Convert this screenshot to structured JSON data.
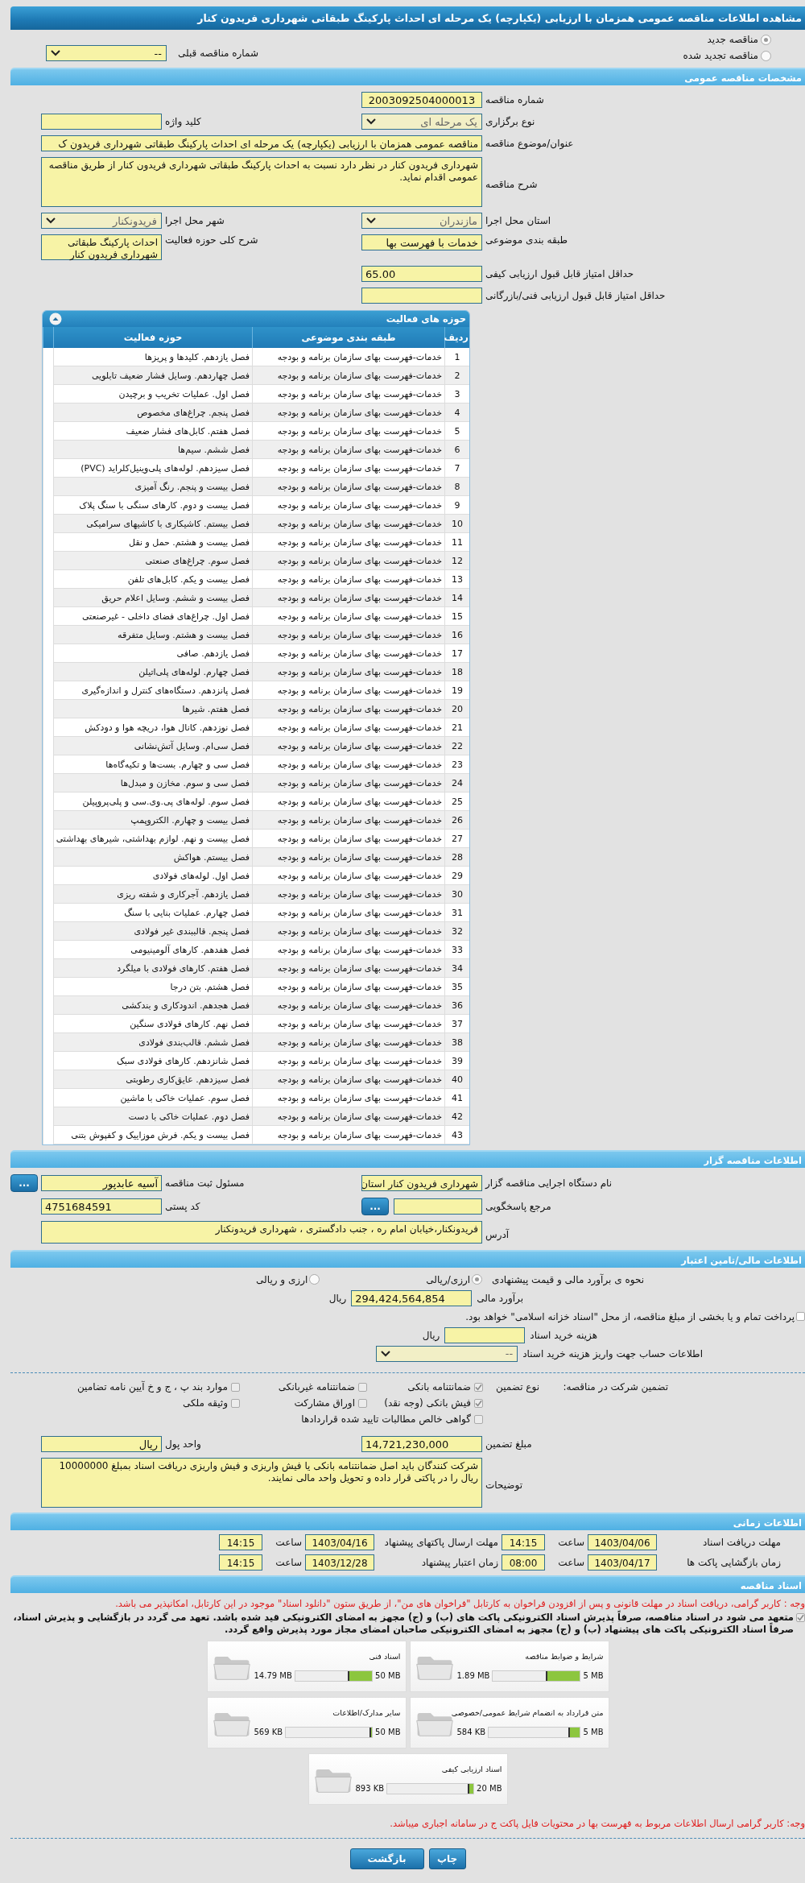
{
  "page_title": "مشاهده اطلاعات مناقصه عمومی همزمان با ارزیابی (یکپارچه) یک مرحله ای احداث پارکینگ طبقاتی شهرداری فریدون کنار",
  "tender_status": [
    {
      "label": "مناقصه جدید",
      "selected": true
    },
    {
      "label": "مناقصه تجدید شده",
      "selected": false
    }
  ],
  "previous_tender": {
    "label": "شماره مناقصه قبلی",
    "value": "--"
  },
  "general": {
    "title": "مشخصات مناقصه عمومی",
    "tender_number": {
      "label": "شماره مناقصه",
      "value": "2003092504000013"
    },
    "holding_type": {
      "label": "نوع برگزاری",
      "value": "یک مرحله ای"
    },
    "keyword": {
      "label": "کلید واژه"
    },
    "subject": {
      "label": "عنوان/موضوع مناقصه",
      "value": "مناقصه عمومی همزمان با ارزیابی (یکپارچه) یک مرحله ای احداث پارکینگ طبقاتی شهرداری فریدون ک"
    },
    "description": {
      "label": "شرح مناقصه",
      "value": "شهرداری فریدون کنار در نظر دارد نسبت به احداث پارکینگ طبقاتی شهرداری فریدون کنار از طریق مناقصه عمومی اقدام نماید."
    },
    "province": {
      "label": "استان محل اجرا",
      "value": "مازندران"
    },
    "city": {
      "label": "شهر محل اجرا",
      "value": "فریدونکنار"
    },
    "subject_class": {
      "label": "طبقه بندی موضوعی",
      "value": "خدمات با فهرست بها"
    },
    "activity_summary": {
      "label": "شرح کلی حوزه فعالیت",
      "value": "احداث پارکینگ طبقاتی شهرداری فریدون کنار"
    },
    "min_quality_score": {
      "label": "حداقل امتیاز قابل قبول ارزیابی کیفی",
      "value": "65.00"
    },
    "min_technical_score": {
      "label": "حداقل امتیاز قابل قبول ارزیابی فنی/بازرگانی"
    }
  },
  "activities": {
    "title": "حوزه های فعالیت",
    "columns": [
      "ردیف",
      "طبقه بندی موضوعی",
      "حوزه فعالیت"
    ],
    "rows": [
      [
        "1",
        "خدمات-فهرست بهای سازمان برنامه و بودجه",
        "فصل یازدهم. کلیدها و پریزها"
      ],
      [
        "2",
        "خدمات-فهرست بهای سازمان برنامه و بودجه",
        "فصل چهاردهم. وسایل فشار ضعیف تابلویی"
      ],
      [
        "3",
        "خدمات-فهرست بهای سازمان برنامه و بودجه",
        "فصل اول. عملیات تخریب و برچیدن"
      ],
      [
        "4",
        "خدمات-فهرست بهای سازمان برنامه و بودجه",
        "فصل پنجم. چراغ‌های مخصوص"
      ],
      [
        "5",
        "خدمات-فهرست بهای سازمان برنامه و بودجه",
        "فصل هفتم. کابل‌های فشار ضعیف"
      ],
      [
        "6",
        "خدمات-فهرست بهای سازمان برنامه و بودجه",
        "فصل ششم. سیم‌ها"
      ],
      [
        "7",
        "خدمات-فهرست بهای سازمان برنامه و بودجه",
        "فصل سیزدهم. لوله‌های پلی‌وینیل‌کلراید (PVC)"
      ],
      [
        "8",
        "خدمات-فهرست بهای سازمان برنامه و بودجه",
        "فصل بیست و پنجم. رنگ آمیزی"
      ],
      [
        "9",
        "خدمات-فهرست بهای سازمان برنامه و بودجه",
        "فصل بیست و دوم. کارهای سنگی با سنگ پلاک"
      ],
      [
        "10",
        "خدمات-فهرست بهای سازمان برنامه و بودجه",
        "فصل بیستم. کاشیکاری با کاشیهای سرامیکی"
      ],
      [
        "11",
        "خدمات-فهرست بهای سازمان برنامه و بودجه",
        "فصل بیست و هشتم. حمل و نقل"
      ],
      [
        "12",
        "خدمات-فهرست بهای سازمان برنامه و بودجه",
        "فصل سوم. چراغ‌های صنعتی"
      ],
      [
        "13",
        "خدمات-فهرست بهای سازمان برنامه و بودجه",
        "فصل بیست و یکم. کابل‌های تلفن"
      ],
      [
        "14",
        "خدمات-فهرست بهای سازمان برنامه و بودجه",
        "فصل بیست و ششم. وسایل اعلام حریق"
      ],
      [
        "15",
        "خدمات-فهرست بهای سازمان برنامه و بودجه",
        "فصل اول. چراغ‌های فضای داخلی - غیرصنعتی"
      ],
      [
        "16",
        "خدمات-فهرست بهای سازمان برنامه و بودجه",
        "فصل بیست و هشتم. وسایل متفرقه"
      ],
      [
        "17",
        "خدمات-فهرست بهای سازمان برنامه و بودجه",
        "فصل یازدهم. صافی"
      ],
      [
        "18",
        "خدمات-فهرست بهای سازمان برنامه و بودجه",
        "فصل چهارم. لوله‌های پلی‌اتیلن"
      ],
      [
        "19",
        "خدمات-فهرست بهای سازمان برنامه و بودجه",
        "فصل پانزدهم. دستگاه‌های کنترل و اندازه‌گیری"
      ],
      [
        "20",
        "خدمات-فهرست بهای سازمان برنامه و بودجه",
        "فصل هفتم. شیرها"
      ],
      [
        "21",
        "خدمات-فهرست بهای سازمان برنامه و بودجه",
        "فصل نوزدهم. کانال هوا، دریچه هوا و دودکش"
      ],
      [
        "22",
        "خدمات-فهرست بهای سازمان برنامه و بودجه",
        "فصل سی‌ام. وسایل آتش‌نشانی"
      ],
      [
        "23",
        "خدمات-فهرست بهای سازمان برنامه و بودجه",
        "فصل سی و چهارم. بست‌ها و تکیه‌گاه‌ها"
      ],
      [
        "24",
        "خدمات-فهرست بهای سازمان برنامه و بودجه",
        "فصل سی و سوم. مخازن و مبدل‌ها"
      ],
      [
        "25",
        "خدمات-فهرست بهای سازمان برنامه و بودجه",
        "فصل سوم. لوله‌های پی.وی.سی و پلی‌پروپیلن"
      ],
      [
        "26",
        "خدمات-فهرست بهای سازمان برنامه و بودجه",
        "فصل بیست و چهارم. الکتروپمپ"
      ],
      [
        "27",
        "خدمات-فهرست بهای سازمان برنامه و بودجه",
        "فصل بیست و نهم. لوازم بهداشتی، شیرهای بهداشتی"
      ],
      [
        "28",
        "خدمات-فهرست بهای سازمان برنامه و بودجه",
        "فصل بیستم. هواکش"
      ],
      [
        "29",
        "خدمات-فهرست بهای سازمان برنامه و بودجه",
        "فصل اول. لوله‌های فولادی"
      ],
      [
        "30",
        "خدمات-فهرست بهای سازمان برنامه و بودجه",
        "فصل یازدهم. آجرکاری و شفته ریزی"
      ],
      [
        "31",
        "خدمات-فهرست بهای سازمان برنامه و بودجه",
        "فصل چهارم. عملیات بنایی با سنگ"
      ],
      [
        "32",
        "خدمات-فهرست بهای سازمان برنامه و بودجه",
        "فصل پنجم. قالببندی غیر فولادی"
      ],
      [
        "33",
        "خدمات-فهرست بهای سازمان برنامه و بودجه",
        "فصل هفدهم. کارهای آلومینیومی"
      ],
      [
        "34",
        "خدمات-فهرست بهای سازمان برنامه و بودجه",
        "فصل هفتم. کارهای فولادی با میلگرد"
      ],
      [
        "35",
        "خدمات-فهرست بهای سازمان برنامه و بودجه",
        "فصل هشتم. بتن درجا"
      ],
      [
        "36",
        "خدمات-فهرست بهای سازمان برنامه و بودجه",
        "فصل هجدهم. اندودکاری و بندکشی"
      ],
      [
        "37",
        "خدمات-فهرست بهای سازمان برنامه و بودجه",
        "فصل نهم. کارهای فولادی سنگین"
      ],
      [
        "38",
        "خدمات-فهرست بهای سازمان برنامه و بودجه",
        "فصل ششم. قالب‌بندی فولادی"
      ],
      [
        "39",
        "خدمات-فهرست بهای سازمان برنامه و بودجه",
        "فصل شانزدهم. کارهای فولادی سبک"
      ],
      [
        "40",
        "خدمات-فهرست بهای سازمان برنامه و بودجه",
        "فصل سیزدهم. عایق‌کاری رطوبتی"
      ],
      [
        "41",
        "خدمات-فهرست بهای سازمان برنامه و بودجه",
        "فصل سوم. عملیات خاکی با ماشین"
      ],
      [
        "42",
        "خدمات-فهرست بهای سازمان برنامه و بودجه",
        "فصل دوم. عملیات خاکی با دست"
      ],
      [
        "43",
        "خدمات-فهرست بهای سازمان برنامه و بودجه",
        "فصل بیست و یکم. فرش موزاییک و کفپوش بتنی"
      ]
    ]
  },
  "organizer": {
    "title": "اطلاعات مناقصه گزار",
    "org_name": {
      "label": "نام دستگاه اجرایی مناقصه گزار",
      "value": "شهرداری فریدون کنار استان"
    },
    "registrar": {
      "label": "مسئول ثبت مناقصه",
      "value": "آسیه عابدپور",
      "button": "..."
    },
    "reference": {
      "label": "مرجع پاسخگویی",
      "button": "..."
    },
    "postal_code": {
      "label": "کد پستی",
      "value": "4751684591"
    },
    "address": {
      "label": "آدرس",
      "value": "فریدونکنار،خیابان امام ره ، جنب دادگستری ، شهرداری فریدونکنار"
    }
  },
  "financial": {
    "title": "اطلاعات مالی/تامین اعتبار",
    "estimate_method": {
      "label": "نحوه ی برآورد مالی و قیمت پیشنهادی",
      "options": [
        {
          "label": "ارزی/ریالی",
          "selected": true
        },
        {
          "label": "ارزی و ریالی",
          "selected": false
        }
      ]
    },
    "estimate": {
      "label": "برآورد مالی",
      "value": "294,424,564,854",
      "unit": "ریال"
    },
    "treasury": {
      "label": "پرداخت تمام و یا بخشی از مبلغ مناقصه، از محل \"اسناد خزانه اسلامی\" خواهد بود.",
      "checked": false
    },
    "document_fee": {
      "label": "هزینه خرید اسناد",
      "unit": "ریال"
    },
    "fee_account": {
      "label": "اطلاعات حساب جهت واریز هزینه خرید اسناد",
      "value": "--"
    },
    "guarantee": {
      "label": "تضمین شرکت در مناقصه:",
      "type_label": "نوع تضمین",
      "options": [
        {
          "label": "ضمانتنامه بانکی",
          "checked": true
        },
        {
          "label": "ضمانتنامه غیربانکی",
          "checked": false
        },
        {
          "label": "موارد بند پ ، ج و خ آیین نامه تضامین",
          "checked": false
        },
        {
          "label": "فیش بانکی (وجه نقد)",
          "checked": true
        },
        {
          "label": "اوراق مشارکت",
          "checked": false
        },
        {
          "label": "وثیقه ملکی",
          "checked": false
        },
        {
          "label": "گواهی خالص مطالبات تایید شده قراردادها",
          "checked": false
        }
      ]
    },
    "guarantee_amount": {
      "label": "مبلغ تضمین",
      "value": "14,721,230,000"
    },
    "currency": {
      "label": "واحد پول",
      "value": "ریال"
    },
    "notes": {
      "label": "توضیحات",
      "value": "شرکت کنندگان باید اصل ضمانتنامه بانکی یا فیش واریزی و فیش واریزی دریافت اسناد بمبلغ 10000000 ریال را در پاکتی قرار داده و تحویل واحد مالی نمایند."
    }
  },
  "timing": {
    "title": "اطلاعات زمانی",
    "rows": [
      {
        "label": "مهلت دریافت اسناد",
        "date": "1403/04/06",
        "time_label": "ساعت",
        "time": "14:15"
      },
      {
        "label": "مهلت ارسال پاکتهای پیشنهاد",
        "date": "1403/04/16",
        "time_label": "ساعت",
        "time": "14:15"
      },
      {
        "label": "زمان بازگشایی پاکت ها",
        "date": "1403/04/17",
        "time_label": "ساعت",
        "time": "08:00"
      },
      {
        "label": "زمان اعتبار پیشنهاد",
        "date": "1403/12/28",
        "time_label": "ساعت",
        "time": "14:15"
      }
    ]
  },
  "documents": {
    "title": "اسناد مناقصه",
    "notice": "وجه : کاربر گرامی، دریافت اسناد در مهلت قانونی و پس از افزودن فراخوان به کارتابل \"فراخوان های من\"، از طریق ستون \"دانلود اسناد\" موجود در این کارتابل، امکانپذیر می باشد.",
    "commitment": {
      "checked": true,
      "text": "متعهد می شود در اسناد مناقصه، صرفاً پذیرش اسناد الکترونیکی پاکت های (ب) و (ج) مجهز به امضای الکترونیکی قید شده باشد. تعهد می گردد در بازگشایی و پذیرش اسناد، صرفاً اسناد الکترونیکی پاکت های پیشنهاد (ب) و (ج) مجهز به امضای الکترونیکی صاحبان امضای مجاز مورد پذیرش واقع گردد."
    },
    "files": [
      {
        "title": "شرایط و ضوابط مناقصه",
        "size": "1.89 MB",
        "max": "5 MB",
        "level": 0.378
      },
      {
        "title": "اسناد فنی",
        "size": "14.79 MB",
        "max": "50 MB",
        "level": 0.296
      },
      {
        "title": "متن قرارداد به انضمام شرایط عمومی/خصوصی",
        "size": "584 KB",
        "max": "5 MB",
        "level": 0.114
      },
      {
        "title": "سایر مدارک/اطلاعات",
        "size": "569 KB",
        "max": "50 MB",
        "level": 0.012
      },
      {
        "title": "اسناد ارزیابی کیفی",
        "size": "893 KB",
        "max": "20 MB",
        "level": 0.044
      }
    ],
    "footer_note": "وجه: کاربر گرامی ارسال اطلاعات مربوط به فهرست بها در محتویات فایل پاکت ج در سامانه اجباری میباشد."
  },
  "buttons": [
    "چاپ",
    "بازگشت"
  ]
}
